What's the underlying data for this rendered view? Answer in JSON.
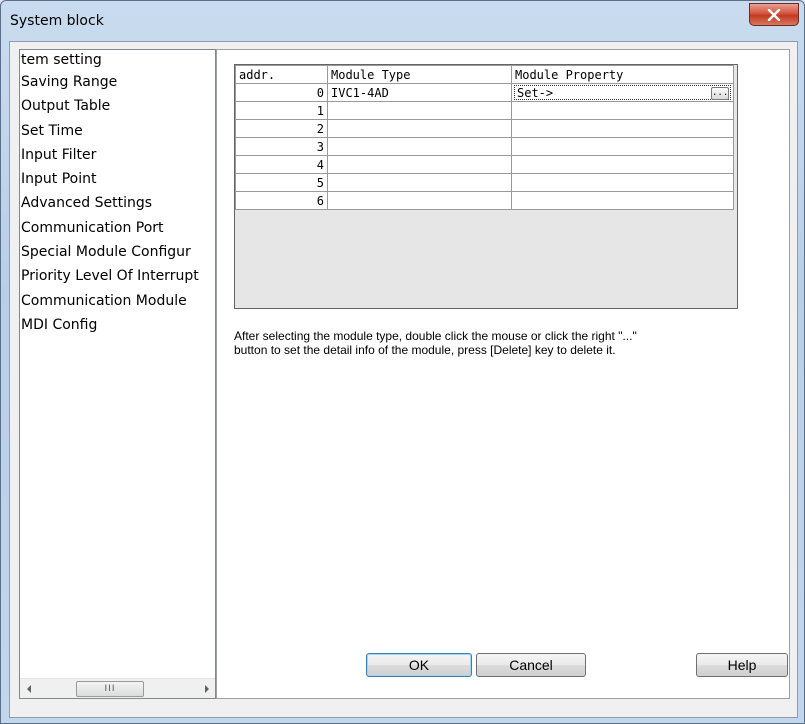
{
  "window": {
    "title": "System block"
  },
  "tree": {
    "items": [
      "tem setting",
      "Saving Range",
      "Output Table",
      "Set Time",
      "Input Filter",
      "Input Point",
      "Advanced Settings",
      "Communication Port",
      "Special Module Configur",
      "Priority Level Of Interrupt",
      "Communication Module",
      "MDI Config"
    ],
    "scroll_thumb_glyph": "III"
  },
  "grid": {
    "headers": [
      "addr.",
      "Module Type",
      "Module Property"
    ],
    "rows": [
      {
        "addr": "0",
        "type": "IVC1-4AD",
        "property": "Set->"
      },
      {
        "addr": "1",
        "type": "",
        "property": ""
      },
      {
        "addr": "2",
        "type": "",
        "property": ""
      },
      {
        "addr": "3",
        "type": "",
        "property": ""
      },
      {
        "addr": "4",
        "type": "",
        "property": ""
      },
      {
        "addr": "5",
        "type": "",
        "property": ""
      },
      {
        "addr": "6",
        "type": "",
        "property": ""
      }
    ],
    "ellipsis_label": "..."
  },
  "help_text": {
    "line1": "After selecting the module type, double click the mouse or click the right \"...\"",
    "line2": "button to set the detail info of the module, press [Delete] key to delete it."
  },
  "buttons": {
    "ok": "OK",
    "cancel": "Cancel",
    "help": "Help"
  },
  "icons": {
    "close": "close-icon",
    "scroll_left": "arrow-left-icon",
    "scroll_right": "arrow-right-icon"
  }
}
